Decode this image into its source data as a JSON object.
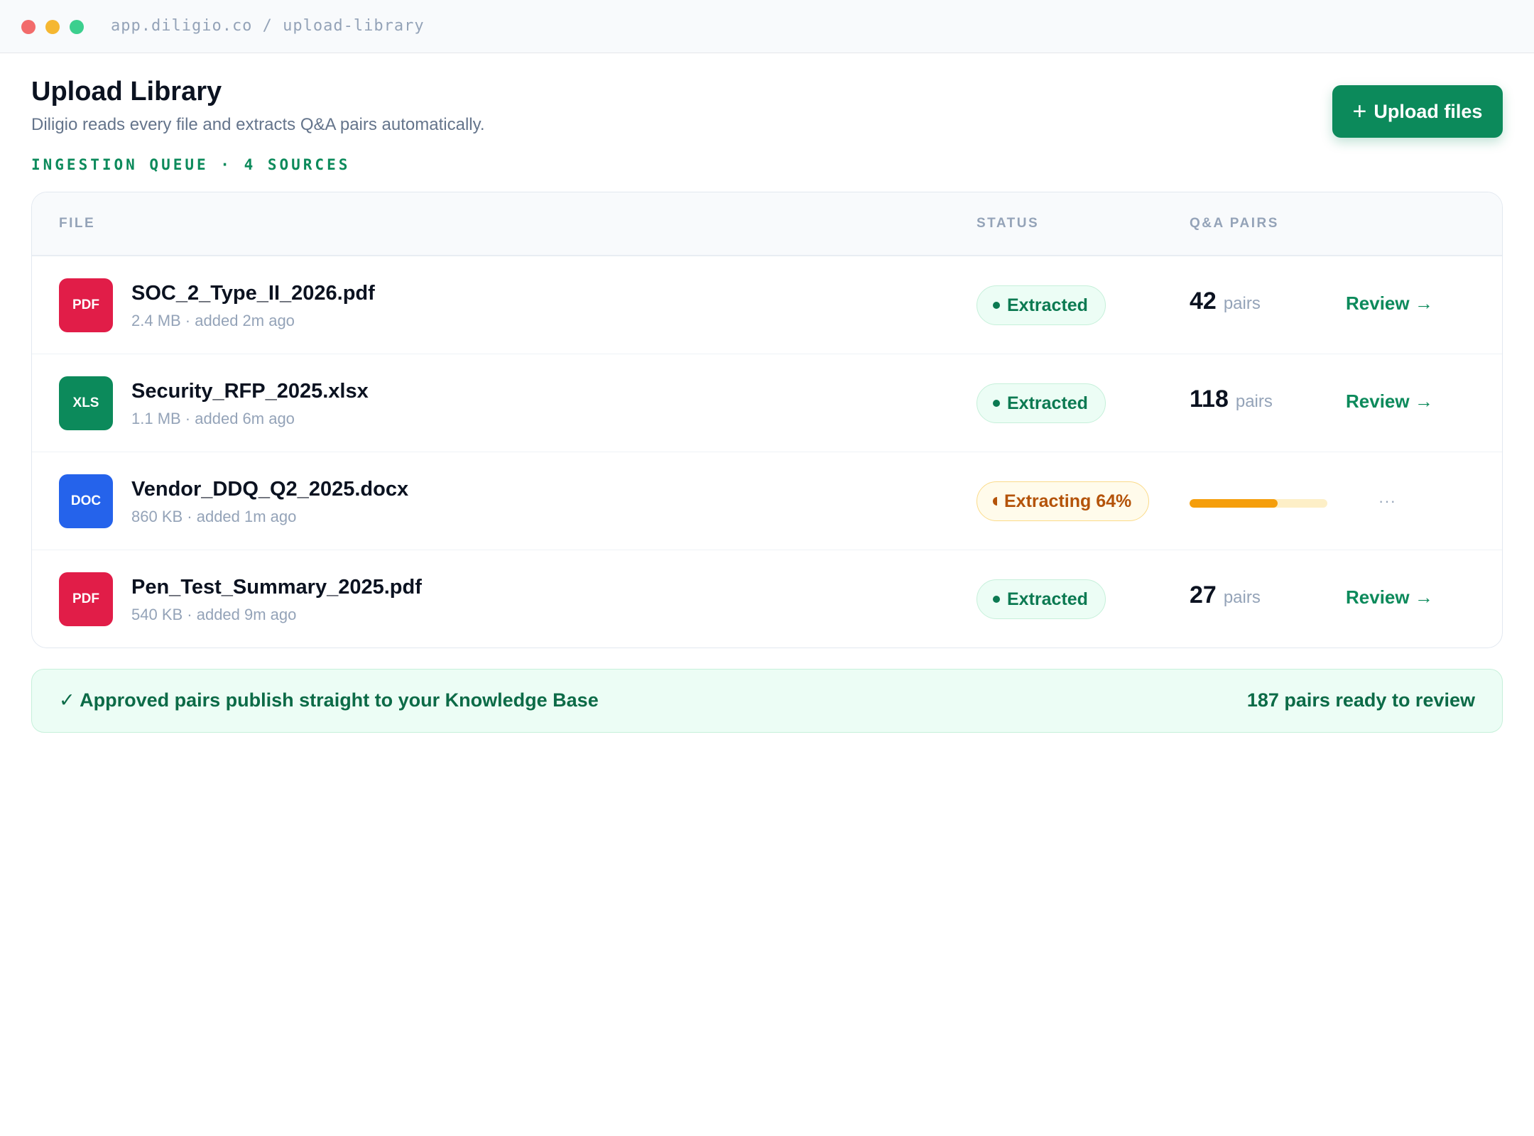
{
  "window": {
    "url": "app.diligio.co / upload-library"
  },
  "header": {
    "title": "Upload Library",
    "subtitle": "Diligio reads every file and extracts Q&A pairs automatically.",
    "upload_button": {
      "icon": "plus-icon",
      "plus_glyph": "+",
      "label": "Upload files"
    },
    "queue_label": "INGESTION QUEUE · 4 SOURCES"
  },
  "table": {
    "columns": {
      "file": "FILE",
      "status": "STATUS",
      "pairs": "Q&A PAIRS"
    },
    "rows": [
      {
        "type": "PDF",
        "type_color": "#e11d48",
        "name": "SOC_2_Type_II_2026.pdf",
        "meta": "2.4 MB · added 2m ago",
        "status": "Extracted",
        "count": "42",
        "count_unit": "pairs",
        "action": "Review →"
      },
      {
        "type": "XLS",
        "type_color": "#0c8a5b",
        "name": "Security_RFP_2025.xlsx",
        "meta": "1.1 MB · added 6m ago",
        "status": "Extracted",
        "count": "118",
        "count_unit": "pairs",
        "action": "Review →"
      },
      {
        "type": "DOC",
        "type_color": "#2563eb",
        "name": "Vendor_DDQ_Q2_2025.docx",
        "meta": "860 KB · added 1m ago",
        "status": "Extracting 64%",
        "progress": 0.64,
        "pending": "···"
      },
      {
        "type": "PDF",
        "type_color": "#e11d48",
        "name": "Pen_Test_Summary_2025.pdf",
        "meta": "540 KB · added 9m ago",
        "status": "Extracted",
        "count": "27",
        "count_unit": "pairs",
        "action": "Review →"
      }
    ]
  },
  "footer": {
    "message": "✓ Approved pairs publish straight to your Knowledge Base",
    "summary": "187 pairs ready to review"
  }
}
